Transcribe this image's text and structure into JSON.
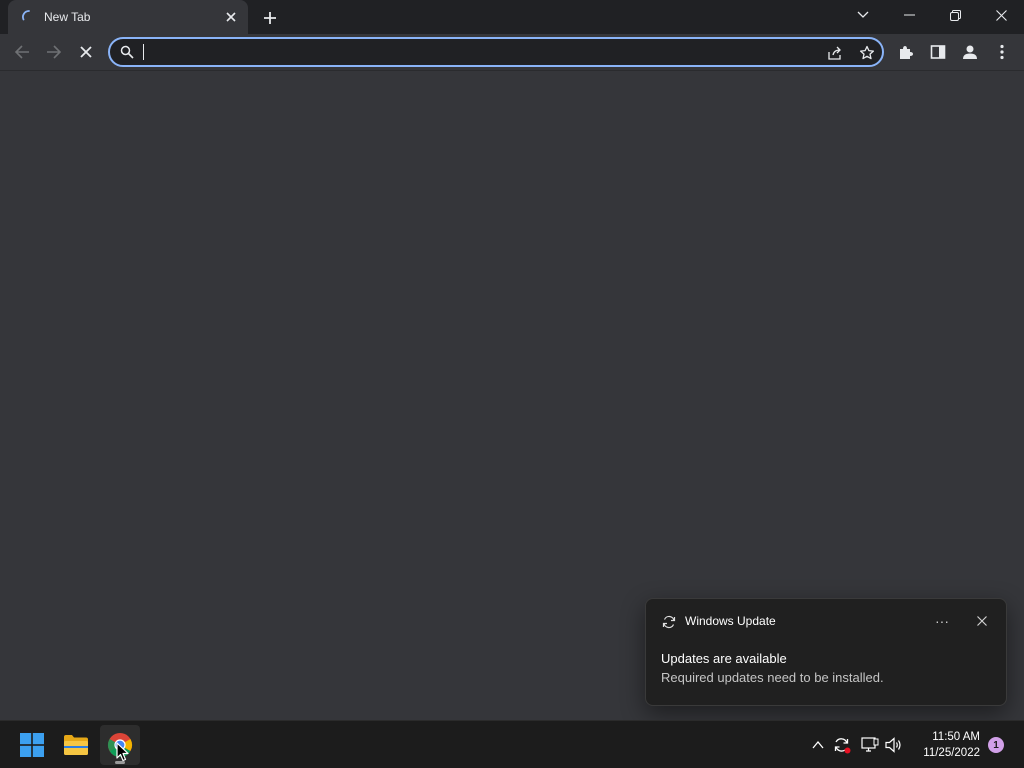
{
  "browser": {
    "tab": {
      "title": "New Tab",
      "loading_icon": "spinner-icon",
      "close_icon": "close-icon"
    },
    "new_tab_icon": "plus-icon",
    "window_controls": {
      "tab_search_icon": "chevron-down-icon",
      "minimize_icon": "minimize-icon",
      "restore_icon": "restore-icon",
      "close_icon": "close-icon"
    },
    "toolbar": {
      "back_icon": "back-arrow-icon",
      "forward_icon": "forward-arrow-icon",
      "stop_icon": "stop-icon",
      "omnibox": {
        "value": "",
        "search_icon": "search-icon",
        "share_icon": "share-icon",
        "bookmark_icon": "star-icon"
      },
      "extensions_icon": "puzzle-icon",
      "side_panel_icon": "side-panel-icon",
      "profile_icon": "profile-icon",
      "menu_icon": "kebab-menu-icon"
    },
    "accent_color": "#8ab4f8",
    "background_color": "#35363a"
  },
  "notification": {
    "app_name": "Windows Update",
    "app_icon": "sync-icon",
    "more_label": "···",
    "title": "Updates are available",
    "body": "Required updates need to be installed."
  },
  "taskbar": {
    "apps": [
      {
        "name": "Start",
        "icon": "windows-logo-icon"
      },
      {
        "name": "File Explorer",
        "icon": "folder-icon"
      },
      {
        "name": "Google Chrome",
        "icon": "chrome-icon",
        "active": true
      }
    ],
    "tray": {
      "overflow_icon": "chevron-up-icon",
      "update_icon": "update-pending-icon",
      "network_icon": "network-icon",
      "volume_icon": "speaker-icon"
    },
    "clock": {
      "time": "11:50 AM",
      "date": "11/25/2022"
    },
    "notification_count": "1"
  }
}
